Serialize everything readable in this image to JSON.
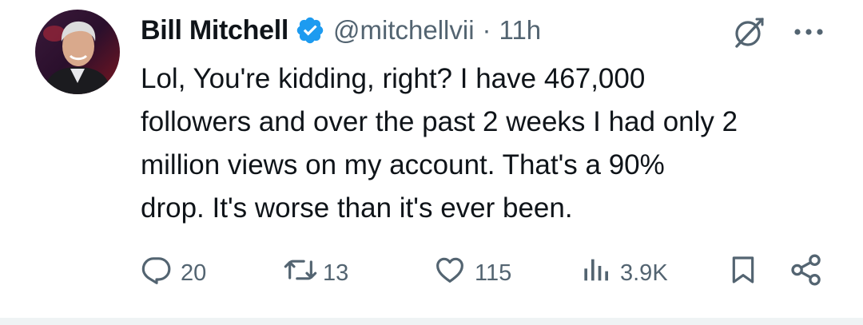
{
  "tweet": {
    "author": {
      "name": "Bill Mitchell",
      "handle": "@mitchellvii",
      "verified": true
    },
    "separator": "·",
    "time": "11h",
    "text": "Lol, You're kidding, right? I have 467,000\nfollowers and over the past 2 weeks I had only 2\nmillion views on my account. That's a 90%\ndrop. It's worse than it's ever been.",
    "actions": {
      "replies": "20",
      "reposts": "13",
      "likes": "115",
      "views": "3.9K"
    }
  },
  "icons": {
    "verified": "verified-badge-icon",
    "grok": "grok-icon",
    "more": "more-icon",
    "reply": "reply-icon",
    "repost": "repost-icon",
    "like": "heart-icon",
    "views": "views-icon",
    "bookmark": "bookmark-icon",
    "share": "share-icon"
  },
  "colors": {
    "text": "#0f1419",
    "secondary": "#536471",
    "verified": "#1d9bf0"
  }
}
